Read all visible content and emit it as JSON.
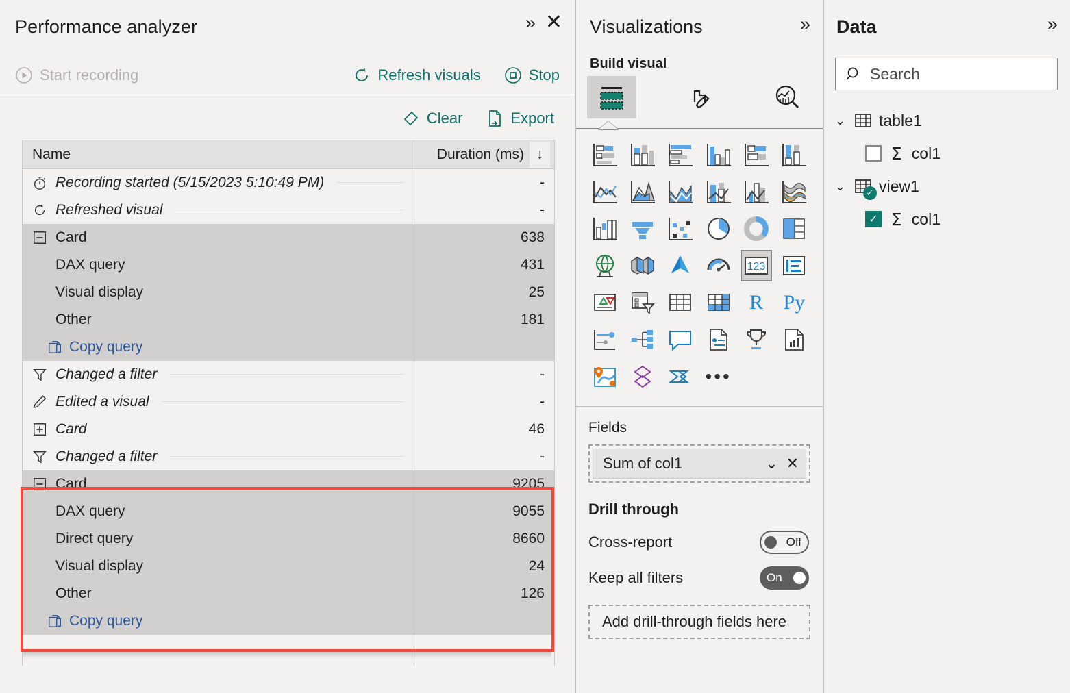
{
  "performance_analyzer": {
    "title": "Performance analyzer",
    "header_icons": {
      "collapse": "chevron-double-right-icon",
      "close": "close-icon"
    },
    "toolbar": {
      "start_recording": "Start recording",
      "refresh_visuals": "Refresh visuals",
      "stop": "Stop"
    },
    "subbar": {
      "clear": "Clear",
      "export": "Export"
    },
    "table": {
      "columns": [
        "Name",
        "Duration (ms)"
      ],
      "sort_indicator": "↓",
      "rows": [
        {
          "icon": "stopwatch-icon",
          "name": "Recording started (5/15/2023 5:10:49 PM)",
          "duration": "-",
          "style": "event"
        },
        {
          "icon": "refresh-icon",
          "name": "Refreshed visual",
          "duration": "-",
          "style": "event"
        },
        {
          "icon": "collapse-minus-icon",
          "name": "Card",
          "duration": "638",
          "style": "group"
        },
        {
          "icon": "",
          "name": "DAX query",
          "duration": "431",
          "style": "child"
        },
        {
          "icon": "",
          "name": "Visual display",
          "duration": "25",
          "style": "child"
        },
        {
          "icon": "",
          "name": "Other",
          "duration": "181",
          "style": "child"
        },
        {
          "icon": "copy-icon",
          "name": "Copy query",
          "duration": "",
          "style": "copy"
        },
        {
          "icon": "funnel-icon",
          "name": "Changed a filter",
          "duration": "-",
          "style": "event"
        },
        {
          "icon": "pencil-icon",
          "name": "Edited a visual",
          "duration": "-",
          "style": "event"
        },
        {
          "icon": "expand-plus-icon",
          "name": "Card",
          "duration": "46",
          "style": "event-solid"
        },
        {
          "icon": "funnel-icon",
          "name": "Changed a filter",
          "duration": "-",
          "style": "event"
        },
        {
          "icon": "collapse-minus-icon",
          "name": "Card",
          "duration": "9205",
          "style": "group"
        },
        {
          "icon": "",
          "name": "DAX query",
          "duration": "9055",
          "style": "child"
        },
        {
          "icon": "",
          "name": "Direct query",
          "duration": "8660",
          "style": "child"
        },
        {
          "icon": "",
          "name": "Visual display",
          "duration": "24",
          "style": "child"
        },
        {
          "icon": "",
          "name": "Other",
          "duration": "126",
          "style": "child"
        },
        {
          "icon": "copy-icon",
          "name": "Copy query",
          "duration": "",
          "style": "copy"
        }
      ]
    },
    "highlight_color": "#f4483c"
  },
  "visualizations": {
    "title": "Visualizations",
    "build_visual_label": "Build visual",
    "tabs": [
      {
        "name": "build-visual-tab",
        "icon": "fields-build-icon",
        "selected": true
      },
      {
        "name": "format-visual-tab",
        "icon": "paintbrush-icon",
        "selected": false
      },
      {
        "name": "analytics-tab",
        "icon": "magnifier-chart-icon",
        "selected": false
      }
    ],
    "chart_icons": [
      "stacked-bar-chart-icon",
      "stacked-column-chart-icon",
      "clustered-bar-chart-icon",
      "clustered-column-chart-icon",
      "hundred-percent-stacked-bar-chart-icon",
      "hundred-percent-stacked-column-chart-icon",
      "line-chart-icon",
      "area-chart-icon",
      "stacked-area-chart-icon",
      "line-stacked-column-chart-icon",
      "line-clustered-column-chart-icon",
      "ribbon-chart-icon",
      "waterfall-chart-icon",
      "funnel-chart-icon",
      "scatter-chart-icon",
      "pie-chart-icon",
      "donut-chart-icon",
      "treemap-icon",
      "map-icon",
      "filled-map-icon",
      "azure-map-icon",
      "gauge-icon",
      "card-icon",
      "multi-row-card-icon",
      "kpi-icon",
      "slicer-icon",
      "table-icon",
      "matrix-icon",
      "r-script-visual-icon",
      "python-visual-icon",
      "key-influencers-icon",
      "decomposition-tree-icon",
      "qa-visual-icon",
      "smart-narrative-icon",
      "metrics-icon",
      "paginated-report-icon",
      "arcgis-map-icon",
      "power-apps-icon",
      "power-automate-icon",
      "more-options-icon"
    ],
    "fields": {
      "label": "Fields",
      "chip": "Sum of col1",
      "chip_dropdown_icon": "chevron-down-icon",
      "chip_remove_icon": "close-icon"
    },
    "drill_through": {
      "label": "Drill through",
      "cross_report": {
        "label": "Cross-report",
        "state": "Off"
      },
      "keep_all_filters": {
        "label": "Keep all filters",
        "state": "On"
      },
      "drop_zone": "Add drill-through fields here"
    }
  },
  "data_pane": {
    "title": "Data",
    "collapse_icon": "chevron-double-right-icon",
    "search_placeholder": "Search",
    "tree": [
      {
        "label": "table1",
        "type": "table",
        "expanded": true,
        "checked": false,
        "badge": false
      },
      {
        "label": "col1",
        "type": "column",
        "checked": false,
        "indent": 1
      },
      {
        "label": "view1",
        "type": "table",
        "expanded": true,
        "checked": true,
        "badge": true
      },
      {
        "label": "col1",
        "type": "column",
        "checked": true,
        "indent": 1
      }
    ]
  },
  "colors": {
    "accent_teal": "#0f6e66",
    "link_blue": "#2b579a",
    "highlight_red": "#f4483c",
    "panel_bg": "#f3f2f1",
    "row_selected_bg": "#d2d0ce"
  }
}
